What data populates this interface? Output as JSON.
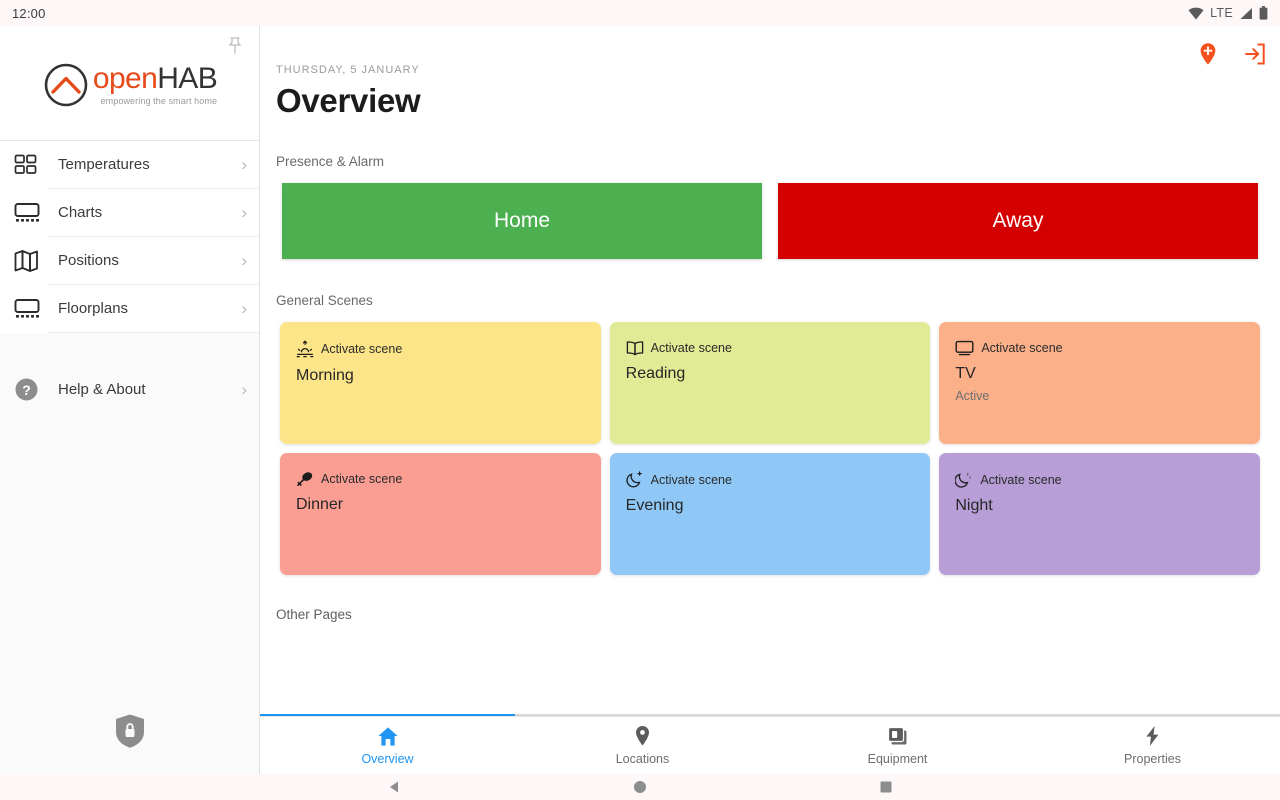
{
  "status_bar": {
    "clock": "12:00",
    "network_label": "LTE",
    "icons": [
      "wifi-icon",
      "signal-icon",
      "battery-icon"
    ]
  },
  "sidebar": {
    "pin_icon": "pushpin-icon",
    "logo": {
      "name_prefix": "open",
      "name_suffix": "HAB",
      "tagline": "empowering the smart home",
      "accent_color": "#e64a19"
    },
    "items": [
      {
        "label": "Temperatures",
        "icon": "grid-squares-icon",
        "chevron": "›"
      },
      {
        "label": "Charts",
        "icon": "chart-screen-icon",
        "chevron": "›"
      },
      {
        "label": "Positions",
        "icon": "folded-map-icon",
        "chevron": "›"
      },
      {
        "label": "Floorplans",
        "icon": "floorplan-screen-icon",
        "chevron": "›"
      }
    ],
    "help": {
      "label": "Help & About",
      "icon": "question-circle-icon",
      "chevron": "›"
    },
    "bottom_icon": "shield-lock-icon"
  },
  "header": {
    "date": "THURSDAY, 5 JANUARY",
    "title": "Overview",
    "actions": [
      {
        "name": "add-location-pin-icon",
        "color": "#f4511e"
      },
      {
        "name": "logout-icon",
        "color": "#f4511e"
      }
    ]
  },
  "presence": {
    "section_label": "Presence & Alarm",
    "buttons": [
      {
        "label": "Home",
        "color": "#4caf50"
      },
      {
        "label": "Away",
        "color": "#d40000"
      }
    ]
  },
  "scenes": {
    "section_label": "General Scenes",
    "action_label": "Activate scene",
    "cards": [
      {
        "name": "Morning",
        "icon": "sunrise-icon",
        "color": "#fce588",
        "state": ""
      },
      {
        "name": "Reading",
        "icon": "open-book-icon",
        "color": "#e1eb95",
        "state": ""
      },
      {
        "name": "TV",
        "icon": "tv-icon",
        "color": "#fbb089",
        "state": "Active"
      },
      {
        "name": "Dinner",
        "icon": "drumstick-icon",
        "color": "#fa9e94",
        "state": ""
      },
      {
        "name": "Evening",
        "icon": "moon-stars-icon",
        "color": "#8fc8f7",
        "state": ""
      },
      {
        "name": "Night",
        "icon": "moon-sleep-icon",
        "color": "#b79ed6",
        "state": ""
      }
    ]
  },
  "other_pages": {
    "label": "Other Pages"
  },
  "scroll": {
    "progress_color": "#2196f3"
  },
  "tabbar": {
    "active_color": "#2196f3",
    "tabs": [
      {
        "label": "Overview",
        "icon": "home-icon",
        "active": true
      },
      {
        "label": "Locations",
        "icon": "map-pin-icon",
        "active": false
      },
      {
        "label": "Equipment",
        "icon": "equipment-icon",
        "active": false
      },
      {
        "label": "Properties",
        "icon": "bolt-icon",
        "active": false
      }
    ]
  },
  "android_nav": {
    "buttons": [
      "back-triangle-icon",
      "home-circle-icon",
      "recents-square-icon"
    ]
  }
}
